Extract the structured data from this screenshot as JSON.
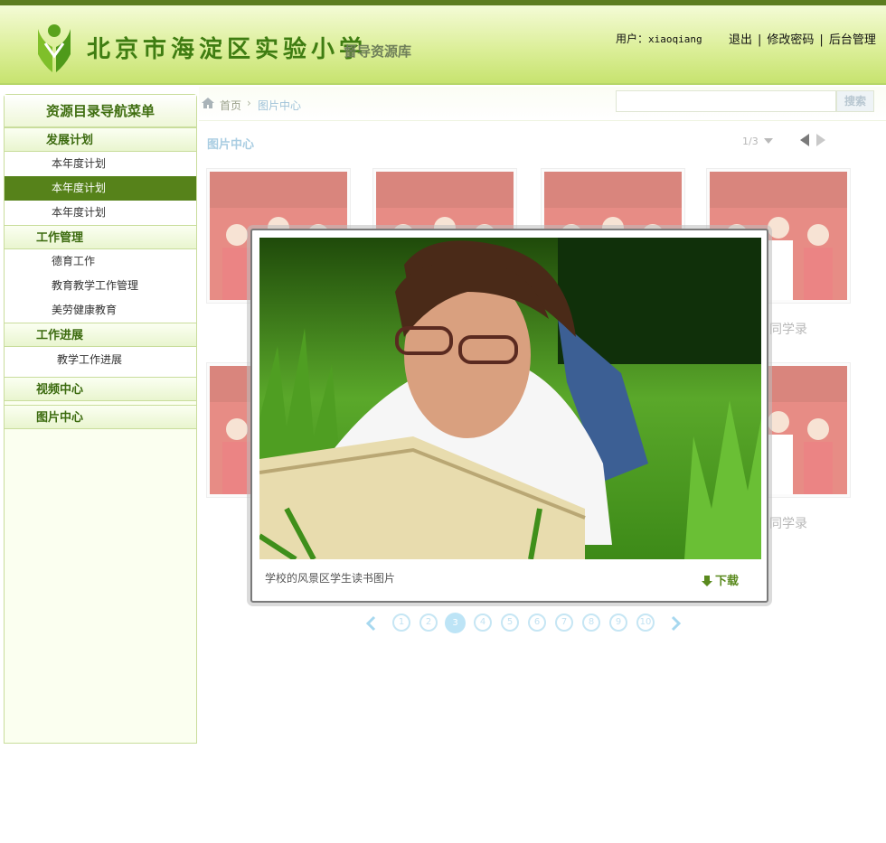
{
  "header": {
    "school_name": "北京市海淀区实验小学",
    "system_name": "督导资源库",
    "user_label": "用户：",
    "username": "xiaoqiang",
    "links": [
      "退出",
      "修改密码",
      "后台管理"
    ],
    "brand_color": "#5d7d20"
  },
  "sidebar": {
    "title": "资源目录导航菜单",
    "groups": [
      {
        "label": "发展计划",
        "items": [
          "本年度计划",
          "本年度计划",
          "本年度计划"
        ],
        "active_index": 1
      },
      {
        "label": "工作管理",
        "items": [
          "德育工作",
          "教育教学工作管理",
          "美劳健康教育"
        ]
      },
      {
        "label": "工作进展",
        "items": [
          "教学工作进展"
        ]
      },
      {
        "label": "视频中心",
        "items": []
      },
      {
        "label": "图片中心",
        "items": []
      }
    ],
    "active_color": "#56821a"
  },
  "breadcrumb": {
    "home": "首页",
    "current": "图片中心"
  },
  "search": {
    "value": "",
    "button": "搜索"
  },
  "section": {
    "title": "图片中心",
    "page_indicator": "1/3"
  },
  "gallery": {
    "captions": [
      "同学录",
      "同学录"
    ]
  },
  "lightbox": {
    "caption": "学校的风景区学生读书图片",
    "download": "下载"
  },
  "pagination": {
    "pages": [
      "1",
      "2",
      "3",
      "4",
      "5",
      "6",
      "7",
      "8",
      "9",
      "10"
    ],
    "current": "3",
    "accent_color": "#bde4f6"
  },
  "icons": [
    "logo-icon",
    "home-icon",
    "dropdown-triangle-icon",
    "prev-arrow-icon",
    "next-arrow-icon",
    "download-arrow-icon"
  ]
}
